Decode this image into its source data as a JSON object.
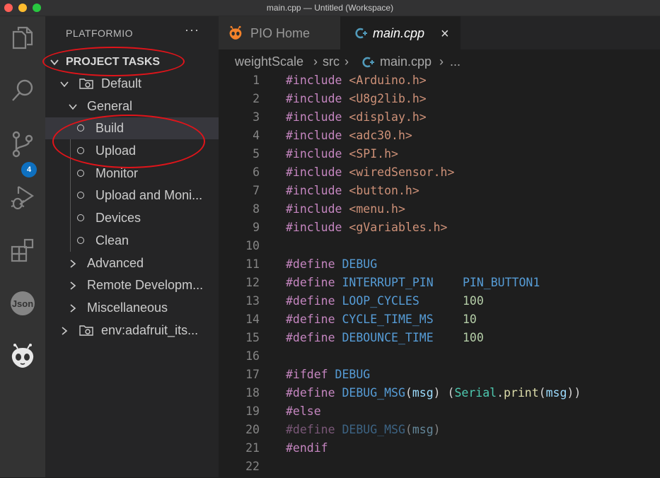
{
  "window": {
    "title": "main.cpp — Untitled (Workspace)"
  },
  "activity_bar": {
    "items": [
      "explorer-icon",
      "search-icon",
      "source-control-icon",
      "run-debug-icon",
      "extensions-icon",
      "json-icon",
      "platformio-icon"
    ],
    "scm_badge": "4",
    "json_label": "Json"
  },
  "sidebar": {
    "title": "PLATFORMIO",
    "more": "···",
    "section": "PROJECT TASKS",
    "tree": {
      "default": "Default",
      "general": "General",
      "tasks": [
        "Build",
        "Upload",
        "Monitor",
        "Upload and Moni...",
        "Devices",
        "Clean"
      ],
      "advanced": "Advanced",
      "remote": "Remote Developm...",
      "misc": "Miscellaneous",
      "env": "env:adafruit_its..."
    }
  },
  "tabs": [
    {
      "label": "PIO Home"
    },
    {
      "label": "main.cpp",
      "close": "×"
    }
  ],
  "breadcrumb": [
    "weightScale",
    "src",
    "main.cpp",
    "..."
  ],
  "code": {
    "line_numbers": [
      "1",
      "2",
      "3",
      "4",
      "5",
      "6",
      "7",
      "8",
      "9",
      "10",
      "11",
      "12",
      "13",
      "14",
      "15",
      "16",
      "17",
      "18",
      "19",
      "20",
      "21",
      "22"
    ],
    "includes": [
      "<Arduino.h>",
      "<U8g2lib.h>",
      "<display.h>",
      "<adc30.h>",
      "<SPI.h>",
      "<wiredSensor.h>",
      "<button.h>",
      "<menu.h>",
      "<gVariables.h>"
    ],
    "kw_include": "#include",
    "kw_define": "#define",
    "kw_ifdef": "#ifdef",
    "kw_else": "#else",
    "kw_endif": "#endif",
    "debug": "DEBUG",
    "defines": [
      {
        "name": "INTERRUPT_PIN",
        "value": "PIN_BUTTON1"
      },
      {
        "name": "LOOP_CYCLES",
        "value": "100"
      },
      {
        "name": "CYCLE_TIME_MS",
        "value": "10"
      },
      {
        "name": "DEBOUNCE_TIME",
        "value": "100"
      }
    ],
    "debug_msg": "DEBUG_MSG",
    "msg": "msg",
    "serial": "Serial",
    "print": "print"
  },
  "colors": {
    "annotation": "#e0141a",
    "accent": "#0e70c0",
    "keyword": "#c586c0",
    "string": "#ce9178",
    "macro": "#569cd6",
    "number": "#b5cea8"
  }
}
